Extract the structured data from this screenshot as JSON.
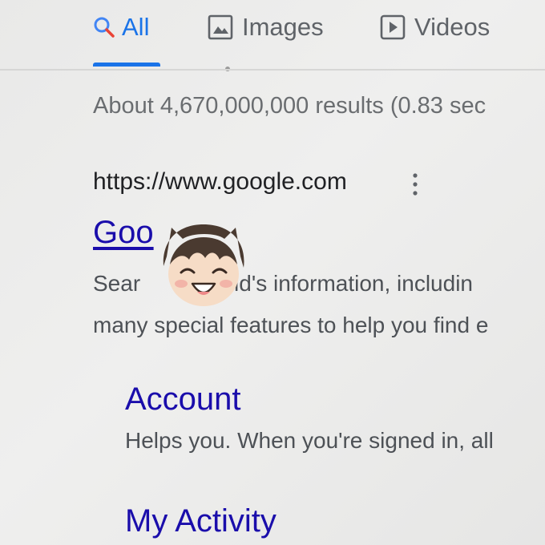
{
  "tabs": [
    {
      "label": "All",
      "icon": "search-icon",
      "active": true
    },
    {
      "label": "Images",
      "icon": "image-icon",
      "active": false
    },
    {
      "label": "Videos",
      "icon": "play-icon",
      "active": false
    }
  ],
  "stats": {
    "text": "About 4,670,000,000 results (0.83 sec"
  },
  "result": {
    "url": "https://www.google.com",
    "title_visible": "Goo",
    "snippet_line1_start": "Sear",
    "snippet_line1_end": "orld's information, includin",
    "snippet_line2": "many special features to help you find e"
  },
  "sitelinks": [
    {
      "title": "Account",
      "description": "Helps you. When you're signed in, all"
    },
    {
      "title": "My Activity"
    }
  ],
  "colors": {
    "accent": "#1a73e8",
    "link": "#1a0dab",
    "text": "#4d5156"
  }
}
